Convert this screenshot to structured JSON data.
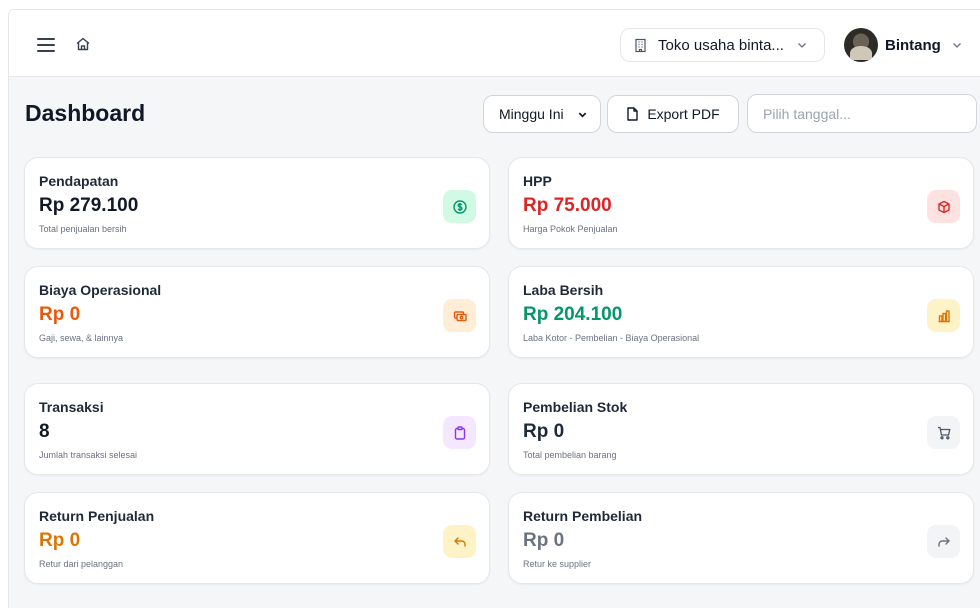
{
  "header": {
    "store_name": "Toko usaha binta...",
    "user_name": "Bintang"
  },
  "page": {
    "title": "Dashboard",
    "period_selected": "Minggu Ini",
    "export_label": "Export PDF",
    "date_placeholder": "Pilih tanggal..."
  },
  "cards": [
    {
      "label": "Pendapatan",
      "value": "Rp 279.100",
      "desc": "Total penjualan bersih",
      "color": "#111827",
      "icon": "dollar-icon",
      "icon_bg": "#d1fae5",
      "icon_color": "#059669"
    },
    {
      "label": "HPP",
      "value": "Rp 75.000",
      "desc": "Harga Pokok Penjualan",
      "color": "#dc2626",
      "icon": "cube-icon",
      "icon_bg": "#fee2e2",
      "icon_color": "#dc2626"
    },
    {
      "label": "Biaya Operasional",
      "value": "Rp 0",
      "desc": "Gaji, sewa, & lainnya",
      "color": "#ea580c",
      "icon": "banknote-icon",
      "icon_bg": "#ffedd5",
      "icon_color": "#ea580c"
    },
    {
      "label": "Laba Bersih",
      "value": "Rp 204.100",
      "desc": "Laba Kotor - Pembelian - Biaya Operasional",
      "color": "#059669",
      "icon": "bar-chart-icon",
      "icon_bg": "#fef3c7",
      "icon_color": "#d97706"
    },
    {
      "label": "Transaksi",
      "value": "8",
      "desc": "Jumlah transaksi selesai",
      "color": "#111827",
      "icon": "clipboard-icon",
      "icon_bg": "#f3e8ff",
      "icon_color": "#9333ea"
    },
    {
      "label": "Pembelian Stok",
      "value": "Rp 0",
      "desc": "Total pembelian barang",
      "color": "#1f2937",
      "icon": "cart-icon",
      "icon_bg": "#f3f4f6",
      "icon_color": "#4b5563"
    },
    {
      "label": "Return Penjualan",
      "value": "Rp 0",
      "desc": "Retur dari pelanggan",
      "color": "#d97706",
      "icon": "return-left-icon",
      "icon_bg": "#fef3c7",
      "icon_color": "#d97706"
    },
    {
      "label": "Return Pembelian",
      "value": "Rp 0",
      "desc": "Retur ke supplier",
      "color": "#6b7280",
      "icon": "return-right-icon",
      "icon_bg": "#f3f4f6",
      "icon_color": "#6b7280"
    }
  ]
}
